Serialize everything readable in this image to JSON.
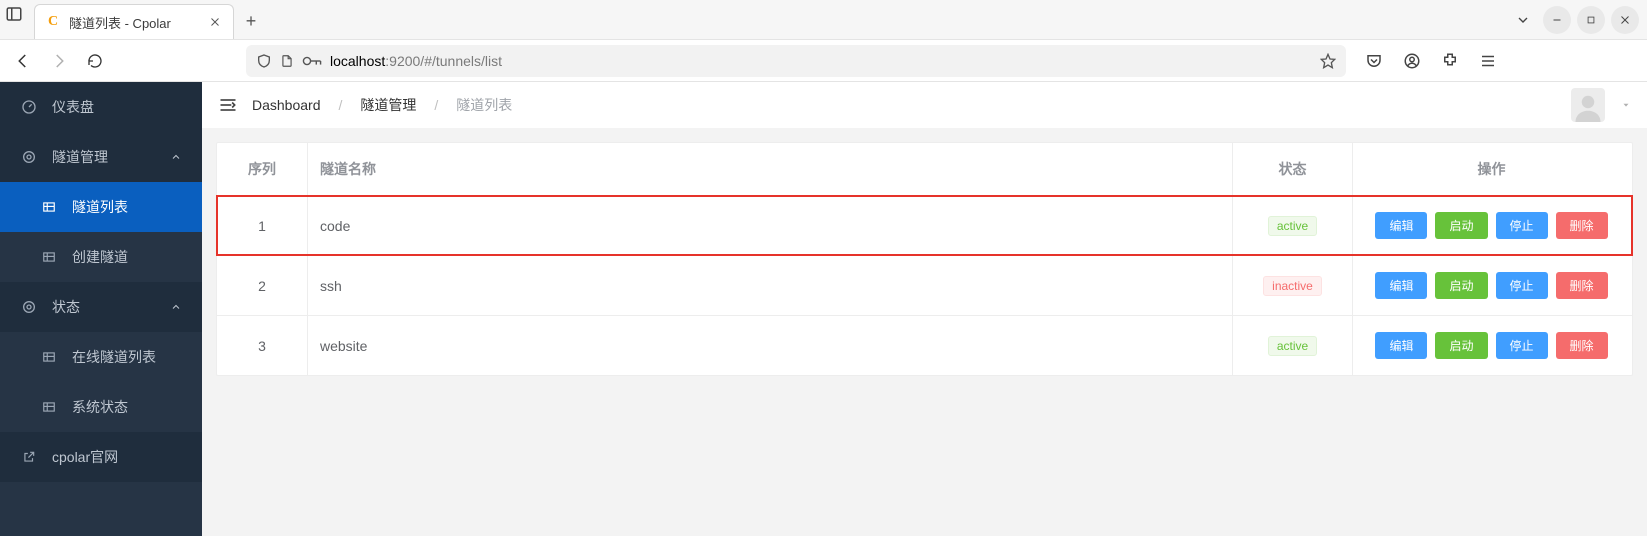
{
  "browser": {
    "tab_title": "隧道列表 - Cpolar",
    "favicon_letter": "C",
    "url_host": "localhost",
    "url_rest": ":9200/#/tunnels/list"
  },
  "sidebar": {
    "dashboard": "仪表盘",
    "tunnel_mgmt": "隧道管理",
    "tunnel_list": "隧道列表",
    "create_tunnel": "创建隧道",
    "status": "状态",
    "online_list": "在线隧道列表",
    "system_status": "系统状态",
    "official_site": "cpolar官网"
  },
  "breadcrumb": {
    "dashboard": "Dashboard",
    "tunnel_mgmt": "隧道管理",
    "tunnel_list": "隧道列表"
  },
  "table": {
    "headers": {
      "idx": "序列",
      "name": "隧道名称",
      "status": "状态",
      "ops": "操作"
    },
    "ops_labels": {
      "edit": "编辑",
      "start": "启动",
      "stop": "停止",
      "delete": "删除"
    },
    "status_labels": {
      "active": "active",
      "inactive": "inactive"
    },
    "rows": [
      {
        "idx": "1",
        "name": "code",
        "status": "active",
        "highlight": true
      },
      {
        "idx": "2",
        "name": "ssh",
        "status": "inactive",
        "highlight": false
      },
      {
        "idx": "3",
        "name": "website",
        "status": "active",
        "highlight": false
      }
    ]
  }
}
